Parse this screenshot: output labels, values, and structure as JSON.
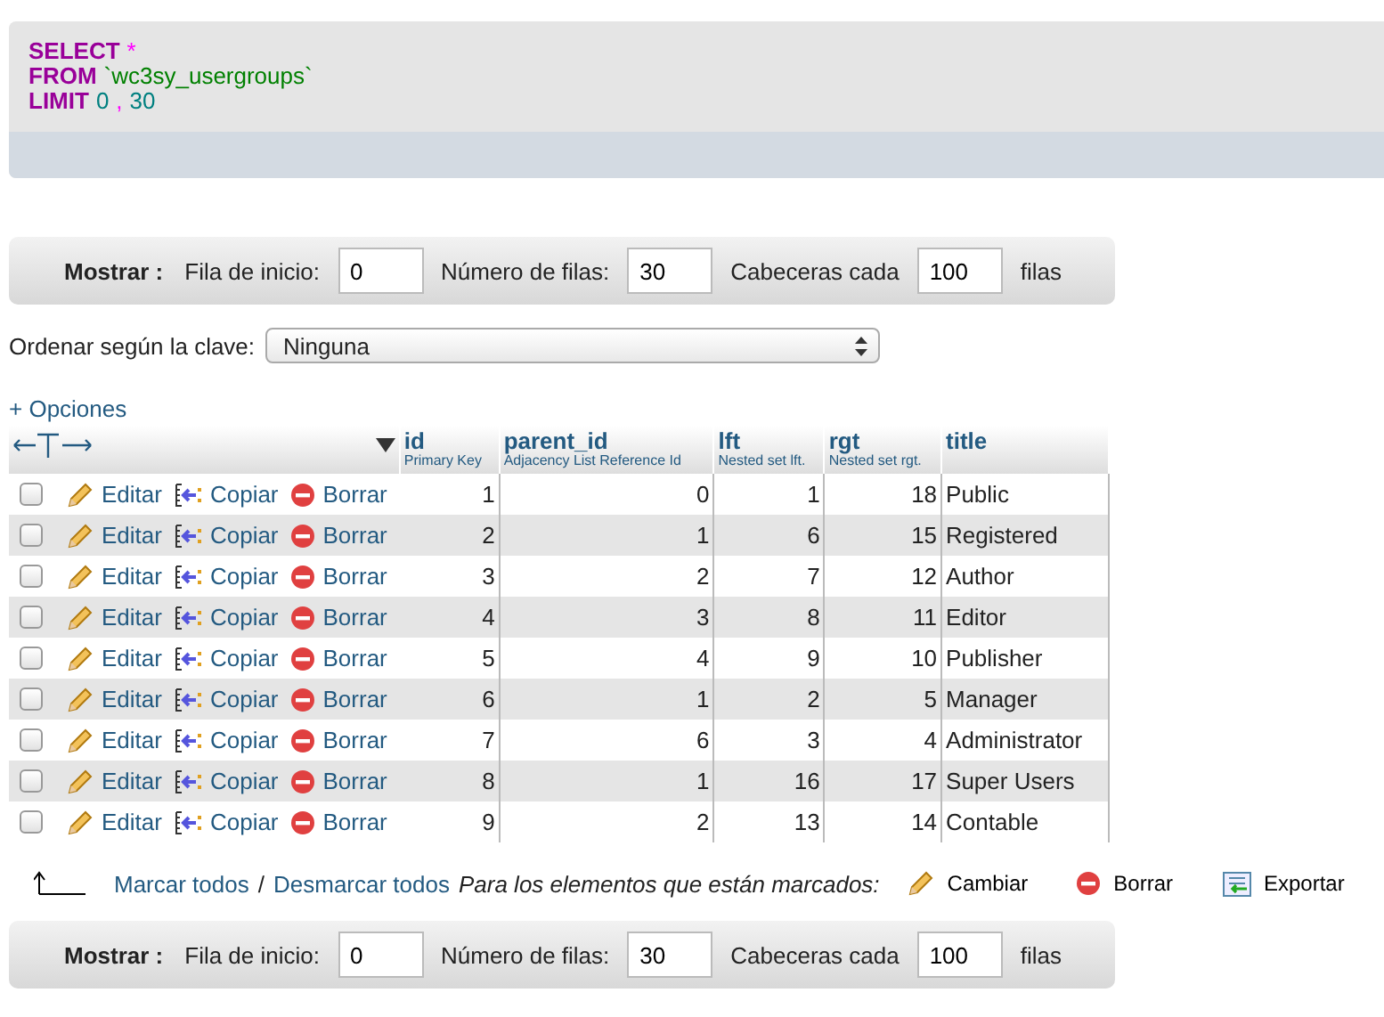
{
  "sql": {
    "lines": [
      [
        {
          "kind": "keyword",
          "text": "SELECT"
        },
        {
          "kind": "operator",
          "text": "*"
        }
      ],
      [
        {
          "kind": "keyword",
          "text": "FROM"
        },
        {
          "kind": "identifier",
          "text": "`wc3sy_usergroups`"
        }
      ],
      [
        {
          "kind": "keyword",
          "text": "LIMIT"
        },
        {
          "kind": "number",
          "text": "0"
        },
        {
          "kind": "operator",
          "text": ","
        },
        {
          "kind": "number",
          "text": "30"
        }
      ]
    ]
  },
  "nav_top": {
    "label": "Mostrar :",
    "start_label": "Fila de inicio:",
    "start": "0",
    "rows_label": "Número de filas:",
    "rows": "30",
    "headers_label": "Cabeceras cada",
    "headers": "100",
    "suffix": "filas"
  },
  "sort": {
    "label": "Ordenar según la clave:",
    "value": "Ninguna"
  },
  "options_link": "+ Opciones",
  "table": {
    "columns": [
      {
        "name": "id",
        "comment": "Primary Key"
      },
      {
        "name": "parent_id",
        "comment": "Adjacency List Reference Id"
      },
      {
        "name": "lft",
        "comment": "Nested set lft."
      },
      {
        "name": "rgt",
        "comment": "Nested set rgt."
      },
      {
        "name": "title"
      }
    ],
    "rows": [
      {
        "checked": false,
        "actions": [
          "Editar",
          "Copiar",
          "Borrar"
        ],
        "cells": [
          "1",
          "0",
          "1",
          "18",
          "Public"
        ]
      },
      {
        "checked": false,
        "actions": [
          "Editar",
          "Copiar",
          "Borrar"
        ],
        "cells": [
          "2",
          "1",
          "6",
          "15",
          "Registered"
        ]
      },
      {
        "checked": false,
        "actions": [
          "Editar",
          "Copiar",
          "Borrar"
        ],
        "cells": [
          "3",
          "2",
          "7",
          "12",
          "Author"
        ]
      },
      {
        "checked": false,
        "actions": [
          "Editar",
          "Copiar",
          "Borrar"
        ],
        "cells": [
          "4",
          "3",
          "8",
          "11",
          "Editor"
        ]
      },
      {
        "checked": false,
        "actions": [
          "Editar",
          "Copiar",
          "Borrar"
        ],
        "cells": [
          "5",
          "4",
          "9",
          "10",
          "Publisher"
        ]
      },
      {
        "checked": false,
        "actions": [
          "Editar",
          "Copiar",
          "Borrar"
        ],
        "cells": [
          "6",
          "1",
          "2",
          "5",
          "Manager"
        ]
      },
      {
        "checked": false,
        "actions": [
          "Editar",
          "Copiar",
          "Borrar"
        ],
        "cells": [
          "7",
          "6",
          "3",
          "4",
          "Administrator"
        ]
      },
      {
        "checked": false,
        "actions": [
          "Editar",
          "Copiar",
          "Borrar"
        ],
        "cells": [
          "8",
          "1",
          "16",
          "17",
          "Super Users"
        ]
      },
      {
        "checked": false,
        "actions": [
          "Editar",
          "Copiar",
          "Borrar"
        ],
        "cells": [
          "9",
          "2",
          "13",
          "14",
          "Contable"
        ]
      }
    ]
  },
  "footer": {
    "check_all": "Marcar todos",
    "separator": "/",
    "uncheck_all": "Desmarcar todos",
    "with_selected": "Para los elementos que están marcados:",
    "actions": [
      {
        "kind": "change",
        "label": "Cambiar"
      },
      {
        "kind": "delete",
        "label": "Borrar"
      },
      {
        "kind": "export",
        "label": "Exportar"
      }
    ]
  },
  "nav_bottom": {
    "label": "Mostrar :",
    "start_label": "Fila de inicio:",
    "start": "0",
    "rows_label": "Número de filas:",
    "rows": "30",
    "headers_label": "Cabeceras cada",
    "headers": "100",
    "suffix": "filas"
  }
}
